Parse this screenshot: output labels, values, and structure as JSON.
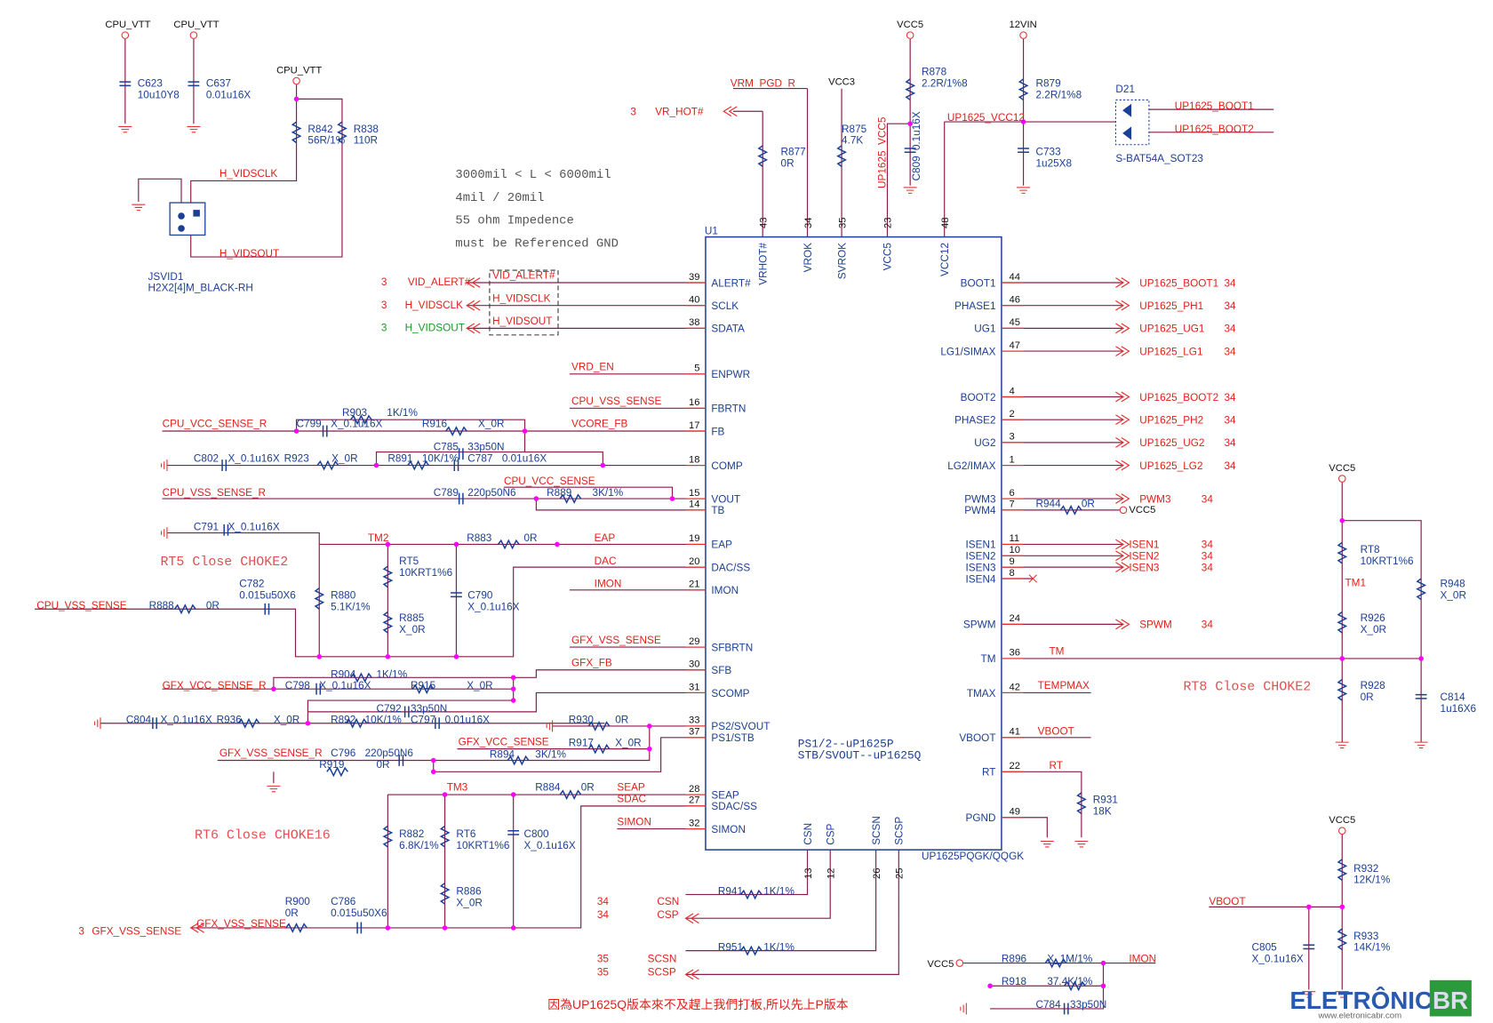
{
  "notes": {
    "n1": "3000mil < L < 6000mil",
    "n2": "4mil / 20mil",
    "n3": "55 ohm Impedence",
    "n4": "must be Referenced GND",
    "rt5": "RT5 Close CHOKE2",
    "rt6": "RT6 Close CHOKE16",
    "rt8": "RT8 Close CHOKE2",
    "ps1": "PS1/2--uP1625P",
    "ps2": "STB/SVOUT--uP1625Q",
    "cn": "因為UP1625Q版本來不及趕上我們打板,所以先上P版本"
  },
  "u1": {
    "ref": "U1",
    "part": "UP1625PQGK/QQGK",
    "left": [
      [
        "39",
        "ALERT#"
      ],
      [
        "40",
        "SCLK"
      ],
      [
        "38",
        "SDATA"
      ],
      [
        "5",
        "ENPWR"
      ],
      [
        "16",
        "FBRTN"
      ],
      [
        "17",
        "FB"
      ],
      [
        "18",
        "COMP"
      ],
      [
        "15",
        "VOUT"
      ],
      [
        "14",
        "TB"
      ],
      [
        "19",
        "EAP"
      ],
      [
        "20",
        "DAC/SS"
      ],
      [
        "21",
        "IMON"
      ],
      [
        "29",
        "SFBRTN"
      ],
      [
        "30",
        "SFB"
      ],
      [
        "31",
        "SCOMP"
      ],
      [
        "33",
        "PS2/SVOUT"
      ],
      [
        "37",
        "PS1/STB"
      ],
      [
        "28",
        "SEAP"
      ],
      [
        "27",
        "SDAC/SS"
      ],
      [
        "32",
        "SIMON"
      ]
    ],
    "right": [
      [
        "44",
        "BOOT1"
      ],
      [
        "46",
        "PHASE1"
      ],
      [
        "45",
        "UG1"
      ],
      [
        "47",
        "LG1/SIMAX"
      ],
      [
        "4",
        "BOOT2"
      ],
      [
        "2",
        "PHASE2"
      ],
      [
        "3",
        "UG2"
      ],
      [
        "1",
        "LG2/IMAX"
      ],
      [
        "6",
        "PWM3"
      ],
      [
        "7",
        "PWM4"
      ],
      [
        "11",
        "ISEN1"
      ],
      [
        "10",
        "ISEN2"
      ],
      [
        "9",
        "ISEN3"
      ],
      [
        "8",
        "ISEN4"
      ],
      [
        "24",
        "SPWM"
      ],
      [
        "36",
        "TM"
      ],
      [
        "42",
        "TMAX"
      ],
      [
        "41",
        "VBOOT"
      ],
      [
        "22",
        "RT"
      ],
      [
        "49",
        "PGND"
      ]
    ],
    "top": [
      [
        "43",
        "VRHOT#"
      ],
      [
        "34",
        "VROK"
      ],
      [
        "35",
        "SVROK"
      ],
      [
        "23",
        "VCC5"
      ],
      [
        "48",
        "VCC12"
      ]
    ],
    "bottom": [
      [
        "13",
        "CSN"
      ],
      [
        "12",
        "CSP"
      ],
      [
        "26",
        "SCSN"
      ],
      [
        "25",
        "SCSP"
      ]
    ]
  },
  "right_nets": [
    [
      "UP1625_BOOT1",
      "34"
    ],
    [
      "UP1625_PH1",
      "34"
    ],
    [
      "UP1625_UG1",
      "34"
    ],
    [
      "UP1625_LG1",
      "34"
    ],
    [
      "UP1625_BOOT2",
      "34"
    ],
    [
      "UP1625_PH2",
      "34"
    ],
    [
      "UP1625_UG2",
      "34"
    ],
    [
      "UP1625_LG2",
      "34"
    ],
    [
      "PWM3",
      "34"
    ],
    [
      "ISEN1",
      "34"
    ],
    [
      "ISEN2",
      "34"
    ],
    [
      "ISEN3",
      "34"
    ],
    [
      "SPWM",
      "34"
    ]
  ],
  "nets": {
    "cpu_vtt1": "CPU_VTT",
    "cpu_vtt2": "CPU_VTT",
    "cpu_vtt3": "CPU_VTT",
    "h_vidsclk_j": "H_VIDSCLK",
    "h_vidsout_j": "H_VIDSOUT",
    "vcc5_a": "VCC5",
    "vin12": "12VIN",
    "vcc3": "VCC3",
    "vrm_pgd": "VRM_PGD_R",
    "vr_hot": "VR_HOT#",
    "vr_hot_pg": "3",
    "up_vcc5": "UP1625_VCC5",
    "up_vcc12": "UP1625_VCC12",
    "d_boot1": "UP1625_BOOT1",
    "d_boot2": "UP1625_BOOT2",
    "pg_alert": "3",
    "vid_alert": "VID_ALERT#",
    "vid_alert_in": "VID_ALERT#",
    "pg_sclk": "3",
    "h_vidsclk": "H_VIDSCLK",
    "h_vidsclk_in": "H_VIDSCLK",
    "pg_sout": "3",
    "h_vidsout": "H_VIDSOUT",
    "h_vidsout_in": "H_VIDSOUT",
    "vrd_en": "VRD_EN",
    "cpu_vss_sense": "CPU_VSS_SENSE",
    "cpu_vcc_sense_r": "CPU_VCC_SENSE_R",
    "vcore_fb": "VCORE_FB",
    "cpu_vcc_sense": "CPU_VCC_SENSE",
    "cpu_vss_sense_r": "CPU_VSS_SENSE_R",
    "tm2": "TM2",
    "eap": "EAP",
    "dac": "DAC",
    "imon": "IMON",
    "cpu_vss_sense2": "CPU_VSS_SENSE",
    "gfx_vss_sense": "GFX_VSS_SENSE",
    "gfx_fb": "GFX_FB",
    "gfx_vcc_sense_r": "GFX_VCC_SENSE_R",
    "gfx_vcc_sense": "GFX_VCC_SENSE",
    "gfx_vss_sense_r": "GFX_VSS_SENSE_R",
    "tm3": "TM3",
    "seap": "SEAP",
    "sdac": "SDAC",
    "simon": "SIMON",
    "pg_gvs": "3",
    "gfx_vss_sense_in": "GFX_VSS_SENSE",
    "gfx_vss_sense2": "GFX_VSS_SENSE",
    "pg_csn": "34",
    "pg_csp": "34",
    "csn": "CSN",
    "csp": "CSP",
    "pg_scsn": "35",
    "pg_scsp": "35",
    "scsn": "SCSN",
    "scsp": "SCSP",
    "vcc5_b": "VCC5",
    "imon2": "IMON",
    "vcc5_c": "VCC5",
    "tm": "TM",
    "tempmax": "TEMPMAX",
    "vboot": "VBOOT",
    "rt": "RT",
    "vcc5_d": "VCC5",
    "tm1": "TM1",
    "vcc5_e": "VCC5",
    "vboot2": "VBOOT"
  },
  "parts": {
    "C623": {
      "ref": "C623",
      "value": "10u10Y8"
    },
    "C637": {
      "ref": "C637",
      "value": "0.01u16X"
    },
    "R842": {
      "ref": "R842",
      "value": "56R/1%"
    },
    "R838": {
      "ref": "R838",
      "value": "110R"
    },
    "JSVID1": {
      "ref": "JSVID1",
      "value": "H2X2[4]M_BLACK-RH"
    },
    "R877": {
      "ref": "R877",
      "value": "0R"
    },
    "R875": {
      "ref": "R875",
      "value": "4.7K"
    },
    "R878": {
      "ref": "R878",
      "value": "2.2R/1%8"
    },
    "C809": {
      "ref": "C809",
      "value": "0.1u16X"
    },
    "R879": {
      "ref": "R879",
      "value": "2.2R/1%8"
    },
    "C733": {
      "ref": "C733",
      "value": "1u25X8"
    },
    "D21": {
      "ref": "D21",
      "value": "S-BAT54A_SOT23"
    },
    "R903": {
      "ref": "R903",
      "value": "1K/1%"
    },
    "C799": {
      "ref": "C799",
      "value": "X_0.1u16X"
    },
    "R916": {
      "ref": "R916",
      "value": "X_0R"
    },
    "C802": {
      "ref": "C802",
      "value": "X_0.1u16X"
    },
    "R923": {
      "ref": "R923",
      "value": "X_0R"
    },
    "C785": {
      "ref": "C785",
      "value": "33p50N"
    },
    "R891": {
      "ref": "R891",
      "value": "10K/1%"
    },
    "C787": {
      "ref": "C787",
      "value": "0.01u16X"
    },
    "C789": {
      "ref": "C789",
      "value": "220p50N6"
    },
    "R889": {
      "ref": "R889",
      "value": "3K/1%"
    },
    "C791": {
      "ref": "C791",
      "value": "X_0.1u16X"
    },
    "R883": {
      "ref": "R883",
      "value": "0R"
    },
    "RT5": {
      "ref": "RT5",
      "value": "10KRT1%6"
    },
    "C782": {
      "ref": "C782",
      "value": "0.015u50X6"
    },
    "R888": {
      "ref": "R888",
      "value": "0R"
    },
    "R880": {
      "ref": "R880",
      "value": "5.1K/1%"
    },
    "R885": {
      "ref": "R885",
      "value": "X_0R"
    },
    "C790": {
      "ref": "C790",
      "value": "X_0.1u16X"
    },
    "R904": {
      "ref": "R904",
      "value": "1K/1%"
    },
    "C798": {
      "ref": "C798",
      "value": "X_0.1u16X"
    },
    "R915": {
      "ref": "R915",
      "value": "X_0R"
    },
    "C792": {
      "ref": "C792",
      "value": "33p50N"
    },
    "C804": {
      "ref": "C804",
      "value": "X_0.1u16X"
    },
    "R936": {
      "ref": "R936",
      "value": "X_0R"
    },
    "R892": {
      "ref": "R892",
      "value": "10K/1%"
    },
    "C797": {
      "ref": "C797",
      "value": "0.01u16X"
    },
    "R930": {
      "ref": "R930",
      "value": "0R"
    },
    "R917": {
      "ref": "R917",
      "value": "X_0R"
    },
    "C796": {
      "ref": "C796",
      "value": "220p50N6"
    },
    "R894": {
      "ref": "R894",
      "value": "3K/1%"
    },
    "R919": {
      "ref": "R919",
      "value": "0R"
    },
    "R884": {
      "ref": "R884",
      "value": "0R"
    },
    "R882": {
      "ref": "R882",
      "value": "6.8K/1%"
    },
    "RT6": {
      "ref": "RT6",
      "value": "10KRT1%6"
    },
    "C800": {
      "ref": "C800",
      "value": "X_0.1u16X"
    },
    "R886": {
      "ref": "R886",
      "value": "X_0R"
    },
    "R900": {
      "ref": "R900",
      "value": "0R"
    },
    "C786": {
      "ref": "C786",
      "value": "0.015u50X6"
    },
    "R941": {
      "ref": "R941",
      "value": "1K/1%"
    },
    "R951": {
      "ref": "R951",
      "value": "1K/1%"
    },
    "R896": {
      "ref": "R896",
      "value": "X_1M/1%"
    },
    "R918": {
      "ref": "R918",
      "value": "37.4K/1%"
    },
    "C784": {
      "ref": "C784",
      "value": "33p50N"
    },
    "R944": {
      "ref": "R944",
      "value": "0R"
    },
    "R931": {
      "ref": "R931",
      "value": "18K"
    },
    "RT8": {
      "ref": "RT8",
      "value": "10KRT1%6"
    },
    "R948": {
      "ref": "R948",
      "value": "X_0R"
    },
    "R926": {
      "ref": "R926",
      "value": "X_0R"
    },
    "R928": {
      "ref": "R928",
      "value": "0R"
    },
    "C814": {
      "ref": "C814",
      "value": "1u16X6"
    },
    "R932": {
      "ref": "R932",
      "value": "12K/1%"
    },
    "R933": {
      "ref": "R933",
      "value": "14K/1%"
    },
    "C805": {
      "ref": "C805",
      "value": "X_0.1u16X"
    }
  },
  "watermark": {
    "brand": "ELETRÔNICA",
    "brand2": "BR",
    "url": "www.eletronicabr.com"
  },
  "colors": {
    "net": "#e0201a",
    "component": "#1b3f94",
    "wire": "#8b1c4a",
    "junction": "#ff00ff"
  }
}
